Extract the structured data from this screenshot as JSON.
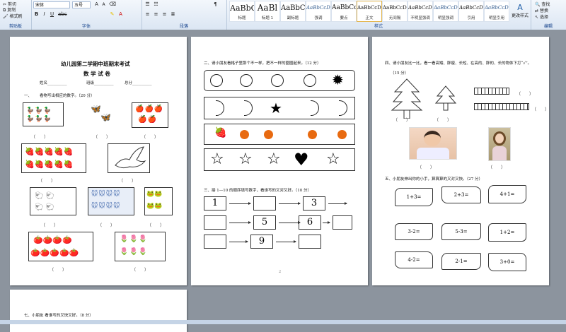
{
  "ribbon": {
    "clipboard": {
      "label": "剪贴板",
      "cut": "剪切",
      "copy": "复制",
      "format_painter": "格式刷"
    },
    "font": {
      "label": "字体",
      "family": "宋体",
      "size": "五号",
      "bold": "B",
      "italic": "I",
      "underline": "U"
    },
    "paragraph": {
      "label": "段落"
    },
    "styles": {
      "label": "样式",
      "items": [
        {
          "sample": "AaBbC",
          "name": "标题"
        },
        {
          "sample": "AaBl",
          "name": "标题 1"
        },
        {
          "sample": "AaBbC",
          "name": "副标题"
        },
        {
          "sample": "AaBbCcDt",
          "name": "强调"
        },
        {
          "sample": "AaBbCcD",
          "name": "要点"
        },
        {
          "sample": "AaBbCcDt",
          "name": "正文"
        },
        {
          "sample": "AaBbCcDt",
          "name": "无间隔"
        },
        {
          "sample": "AaBbCcDt",
          "name": "不明显强调"
        },
        {
          "sample": "AaBbCcDt",
          "name": "明显强调"
        },
        {
          "sample": "AaBbCcDt",
          "name": "引用"
        },
        {
          "sample": "AaBbCcDt",
          "name": "明显引用"
        }
      ],
      "change_styles": "更改样式"
    },
    "editing": {
      "label": "编辑",
      "find": "查找",
      "replace": "替换",
      "select": "选择"
    }
  },
  "page1": {
    "school_title": "幼儿园第二学期中班期末考试",
    "subject_title": "数 学 试 卷",
    "name_label": "姓名",
    "class_label": "班级",
    "score_label": "总分",
    "q1_number": "一、",
    "q1": "看物写出相应的数字。（20 分）",
    "paren": "（　　）"
  },
  "page2": {
    "q2": "二、请小朋友看格子里那个不一样，把不一样的圈圈起来。（12 分）",
    "q3": "三、接 1—10 的顺序填写数字，看谁写的又对又好。（10 分）",
    "numbers": [
      "1",
      "3",
      "5",
      "6",
      "9"
    ],
    "page_num": "2"
  },
  "page3": {
    "q4": "四、请小朋友比一比，看一看高矮、胖瘦、长短、在高的、胖的、长的物体下打“√”。",
    "q4_score": "（15 分）",
    "q5": "五、小朋友伸出你的小手，算算算的又对又快。（27 分）",
    "math": [
      "1+3=",
      "2+3=",
      "4+1=",
      "3-2=",
      "5-3=",
      "1+2=",
      "4-2=",
      "2-1=",
      "3+0="
    ],
    "paren": "（　　）"
  },
  "page4": {
    "q7": "七、小朋友 看谁写的又快又好。（8 分）"
  }
}
